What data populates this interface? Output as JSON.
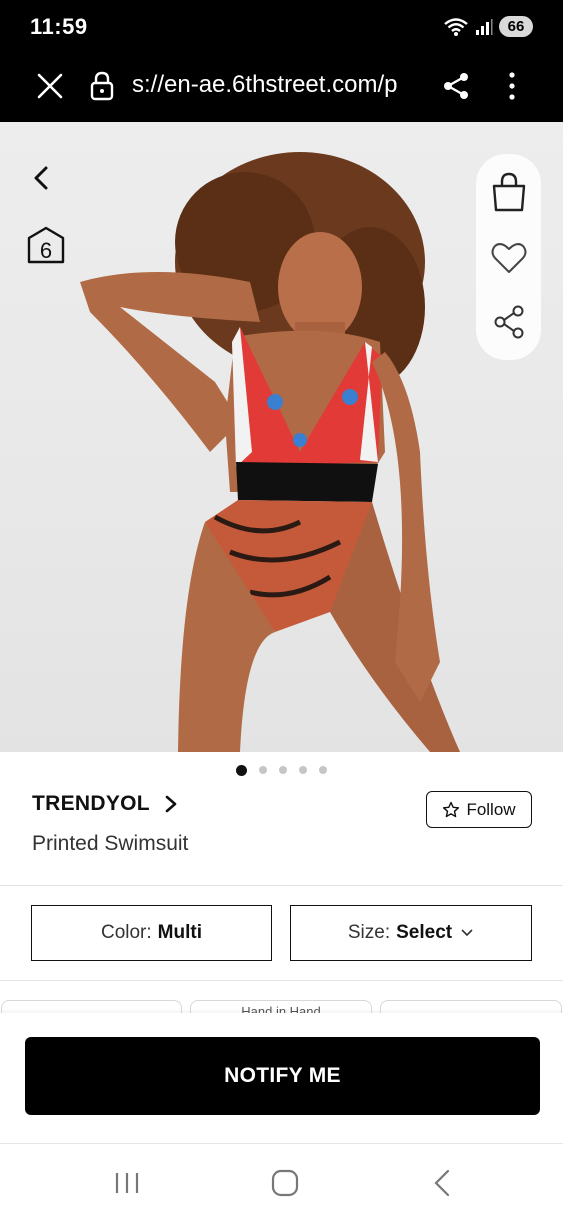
{
  "status_bar": {
    "time": "11:59",
    "battery": "66",
    "wifi_icon": "wifi-icon",
    "signal_icon": "signal-icon"
  },
  "browser": {
    "url": "s://en-ae.6thstreet.com/p",
    "close_icon": "close-icon",
    "lock_icon": "lock-icon",
    "share_icon": "share-icon",
    "menu_icon": "kebab-menu-icon"
  },
  "product_image": {
    "back_icon": "chevron-left-icon",
    "logo_label": "6",
    "actions": [
      "shopping-bag-icon",
      "heart-icon",
      "share-icon"
    ],
    "carousel": {
      "count": 5,
      "active": 0
    }
  },
  "product": {
    "brand": "TRENDYOL",
    "title": "Printed Swimsuit",
    "follow_label": "Follow"
  },
  "options": {
    "color_label": "Color:",
    "color_value": "Multi",
    "size_label": "Size:",
    "size_value": "Select"
  },
  "cards": [
    "",
    "Hand in Hand",
    ""
  ],
  "cta": {
    "notify_label": "NOTIFY ME"
  },
  "colors": {
    "primary": "#000000",
    "background": "#ffffff",
    "divider": "#e3e3e3"
  }
}
